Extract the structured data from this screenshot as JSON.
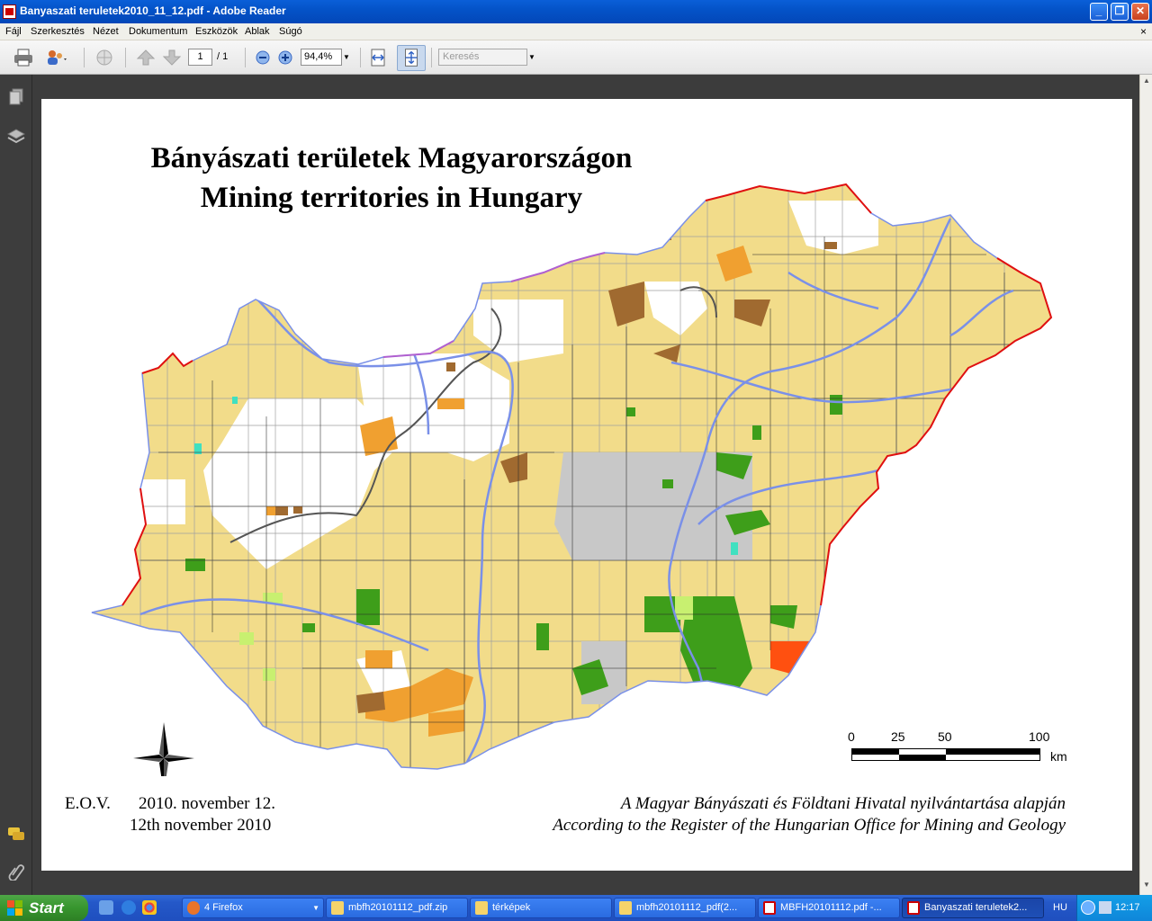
{
  "window": {
    "title": "Banyaszati teruletek2010_11_12.pdf - Adobe Reader",
    "minimize_label": "_",
    "maximize_label": "❐",
    "close_label": "✕"
  },
  "menu": {
    "items": [
      "Fájl",
      "Szerkesztés",
      "Nézet",
      "Dokumentum",
      "Eszközök",
      "Ablak",
      "Súgó"
    ],
    "close_label": "×"
  },
  "toolbar": {
    "page_current": "1",
    "page_total": "/ 1",
    "zoom": "94,4%",
    "search_placeholder": "Keresés"
  },
  "map": {
    "title_hu": "Bányászati területek Magyarországon",
    "title_en": "Mining territories in Hungary",
    "projection": "E.O.V.",
    "date_hu": "2010. november 12.",
    "date_en": "12th november 2010",
    "source_hu": "A Magyar Bányászati és Földtani Hivatal nyilvántartása alapján",
    "source_en": "According to the Register of the Hungarian Office for Mining and Geology",
    "scale": {
      "ticks": [
        "0",
        "25",
        "50",
        "100"
      ],
      "unit": "km"
    },
    "colors": {
      "territory": "#f2dc8a",
      "orange": "#f0a030",
      "brown": "#b07a3a",
      "green": "#3e9e1a",
      "grey": "#c8c8c8",
      "red_area": "#ff5010",
      "river": "#7a90e8",
      "border": "#e01010"
    }
  },
  "taskbar": {
    "start_label": "Start",
    "tasks": [
      {
        "label": "4 Firefox",
        "active": false
      },
      {
        "label": "mbfh20101112_pdf.zip",
        "active": false
      },
      {
        "label": "térképek",
        "active": false
      },
      {
        "label": "mbfh20101112_pdf(2...",
        "active": false
      },
      {
        "label": "MBFH20101112.pdf -...",
        "active": false
      },
      {
        "label": "Banyaszati teruletek2...",
        "active": true
      }
    ],
    "language": "HU",
    "clock": "12:17"
  }
}
